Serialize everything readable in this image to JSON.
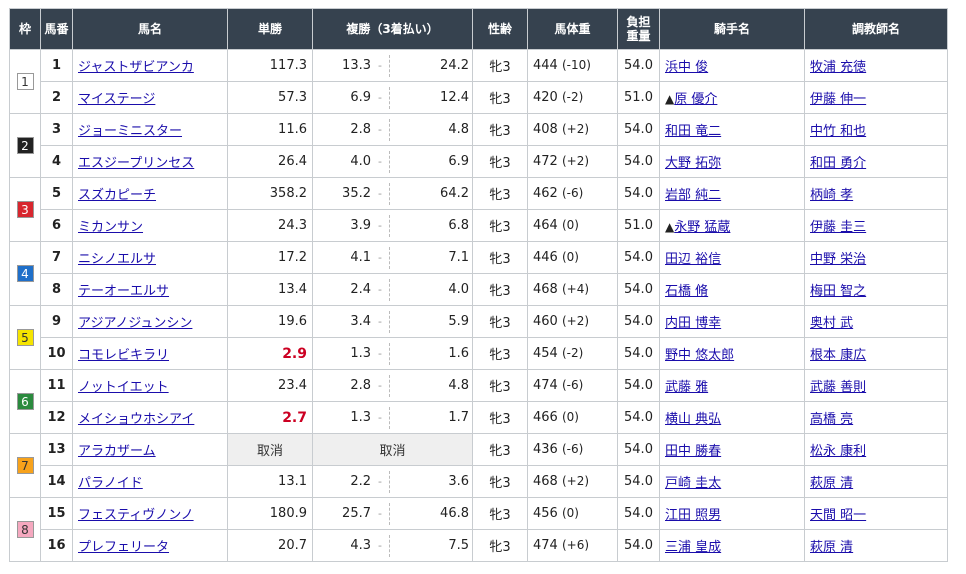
{
  "headers": {
    "waku": "枠",
    "umaban": "馬番",
    "name": "馬名",
    "win": "単勝",
    "place": "複勝（3着払い）",
    "sexage": "性齢",
    "weight": "馬体重",
    "kinryo": "負担\n重量",
    "jockey": "騎手名",
    "trainer": "調教師名"
  },
  "waku_colors": {
    "1": {
      "bg": "#ffffff",
      "fg": "#333333"
    },
    "2": {
      "bg": "#222222",
      "fg": "#ffffff"
    },
    "3": {
      "bg": "#d8262e",
      "fg": "#ffffff"
    },
    "4": {
      "bg": "#1f6fc9",
      "fg": "#ffffff"
    },
    "5": {
      "bg": "#f5e400",
      "fg": "#333333"
    },
    "6": {
      "bg": "#2b8a3e",
      "fg": "#ffffff"
    },
    "7": {
      "bg": "#f7a21b",
      "fg": "#333333"
    },
    "8": {
      "bg": "#f5a8bf",
      "fg": "#333333"
    }
  },
  "scratch_label": "取消",
  "rows": [
    {
      "waku": "1",
      "umaban": "1",
      "name": "ジャストザビアンカ",
      "win": "117.3",
      "place_lo": "13.3",
      "place_hi": "24.2",
      "sexage": "牝3",
      "weight": "444",
      "diff": "(-10)",
      "kinryo": "54.0",
      "mark": "",
      "jockey": "浜中 俊",
      "trainer": "牧浦 充徳",
      "fav": false,
      "scratched": false
    },
    {
      "waku": "1",
      "umaban": "2",
      "name": "マイステージ",
      "win": "57.3",
      "place_lo": "6.9",
      "place_hi": "12.4",
      "sexage": "牝3",
      "weight": "420",
      "diff": "(-2)",
      "kinryo": "51.0",
      "mark": "▲",
      "jockey": "原 優介",
      "trainer": "伊藤 伸一",
      "fav": false,
      "scratched": false
    },
    {
      "waku": "2",
      "umaban": "3",
      "name": "ジョーミニスター",
      "win": "11.6",
      "place_lo": "2.8",
      "place_hi": "4.8",
      "sexage": "牝3",
      "weight": "408",
      "diff": "(+2)",
      "kinryo": "54.0",
      "mark": "",
      "jockey": "和田 竜二",
      "trainer": "中竹 和也",
      "fav": false,
      "scratched": false
    },
    {
      "waku": "2",
      "umaban": "4",
      "name": "エスジープリンセス",
      "win": "26.4",
      "place_lo": "4.0",
      "place_hi": "6.9",
      "sexage": "牝3",
      "weight": "472",
      "diff": "(+2)",
      "kinryo": "54.0",
      "mark": "",
      "jockey": "大野 拓弥",
      "trainer": "和田 勇介",
      "fav": false,
      "scratched": false
    },
    {
      "waku": "3",
      "umaban": "5",
      "name": "スズカピーチ",
      "win": "358.2",
      "place_lo": "35.2",
      "place_hi": "64.2",
      "sexage": "牝3",
      "weight": "462",
      "diff": "(-6)",
      "kinryo": "54.0",
      "mark": "",
      "jockey": "岩部 純二",
      "trainer": "柄崎 孝",
      "fav": false,
      "scratched": false
    },
    {
      "waku": "3",
      "umaban": "6",
      "name": "ミカンサン",
      "win": "24.3",
      "place_lo": "3.9",
      "place_hi": "6.8",
      "sexage": "牝3",
      "weight": "464",
      "diff": "(0)",
      "kinryo": "51.0",
      "mark": "▲",
      "jockey": "永野 猛蔵",
      "trainer": "伊藤 圭三",
      "fav": false,
      "scratched": false
    },
    {
      "waku": "4",
      "umaban": "7",
      "name": "ニシノエルサ",
      "win": "17.2",
      "place_lo": "4.1",
      "place_hi": "7.1",
      "sexage": "牝3",
      "weight": "446",
      "diff": "(0)",
      "kinryo": "54.0",
      "mark": "",
      "jockey": "田辺 裕信",
      "trainer": "中野 栄治",
      "fav": false,
      "scratched": false
    },
    {
      "waku": "4",
      "umaban": "8",
      "name": "テーオーエルサ",
      "win": "13.4",
      "place_lo": "2.4",
      "place_hi": "4.0",
      "sexage": "牝3",
      "weight": "468",
      "diff": "(+4)",
      "kinryo": "54.0",
      "mark": "",
      "jockey": "石橋 脩",
      "trainer": "梅田 智之",
      "fav": false,
      "scratched": false
    },
    {
      "waku": "5",
      "umaban": "9",
      "name": "アジアノジュンシン",
      "win": "19.6",
      "place_lo": "3.4",
      "place_hi": "5.9",
      "sexage": "牝3",
      "weight": "460",
      "diff": "(+2)",
      "kinryo": "54.0",
      "mark": "",
      "jockey": "内田 博幸",
      "trainer": "奥村 武",
      "fav": false,
      "scratched": false
    },
    {
      "waku": "5",
      "umaban": "10",
      "name": "コモレビキラリ",
      "win": "2.9",
      "place_lo": "1.3",
      "place_hi": "1.6",
      "sexage": "牝3",
      "weight": "454",
      "diff": "(-2)",
      "kinryo": "54.0",
      "mark": "",
      "jockey": "野中 悠太郎",
      "trainer": "根本 康広",
      "fav": true,
      "scratched": false
    },
    {
      "waku": "6",
      "umaban": "11",
      "name": "ノットイエット",
      "win": "23.4",
      "place_lo": "2.8",
      "place_hi": "4.8",
      "sexage": "牝3",
      "weight": "474",
      "diff": "(-6)",
      "kinryo": "54.0",
      "mark": "",
      "jockey": "武藤 雅",
      "trainer": "武藤 善則",
      "fav": false,
      "scratched": false
    },
    {
      "waku": "6",
      "umaban": "12",
      "name": "メイショウホシアイ",
      "win": "2.7",
      "place_lo": "1.3",
      "place_hi": "1.7",
      "sexage": "牝3",
      "weight": "466",
      "diff": "(0)",
      "kinryo": "54.0",
      "mark": "",
      "jockey": "横山 典弘",
      "trainer": "高橋 亮",
      "fav": true,
      "scratched": false
    },
    {
      "waku": "7",
      "umaban": "13",
      "name": "アラカザーム",
      "win": "",
      "place_lo": "",
      "place_hi": "",
      "sexage": "牝3",
      "weight": "436",
      "diff": "(-6)",
      "kinryo": "54.0",
      "mark": "",
      "jockey": "田中 勝春",
      "trainer": "松永 康利",
      "fav": false,
      "scratched": true
    },
    {
      "waku": "7",
      "umaban": "14",
      "name": "パラノイド",
      "win": "13.1",
      "place_lo": "2.2",
      "place_hi": "3.6",
      "sexage": "牝3",
      "weight": "468",
      "diff": "(+2)",
      "kinryo": "54.0",
      "mark": "",
      "jockey": "戸崎 圭太",
      "trainer": "萩原 清",
      "fav": false,
      "scratched": false
    },
    {
      "waku": "8",
      "umaban": "15",
      "name": "フェスティヴノンノ",
      "win": "180.9",
      "place_lo": "25.7",
      "place_hi": "46.8",
      "sexage": "牝3",
      "weight": "456",
      "diff": "(0)",
      "kinryo": "54.0",
      "mark": "",
      "jockey": "江田 照男",
      "trainer": "天間 昭一",
      "fav": false,
      "scratched": false
    },
    {
      "waku": "8",
      "umaban": "16",
      "name": "プレフェリータ",
      "win": "20.7",
      "place_lo": "4.3",
      "place_hi": "7.5",
      "sexage": "牝3",
      "weight": "474",
      "diff": "(+6)",
      "kinryo": "54.0",
      "mark": "",
      "jockey": "三浦 皇成",
      "trainer": "萩原 清",
      "fav": false,
      "scratched": false
    }
  ]
}
